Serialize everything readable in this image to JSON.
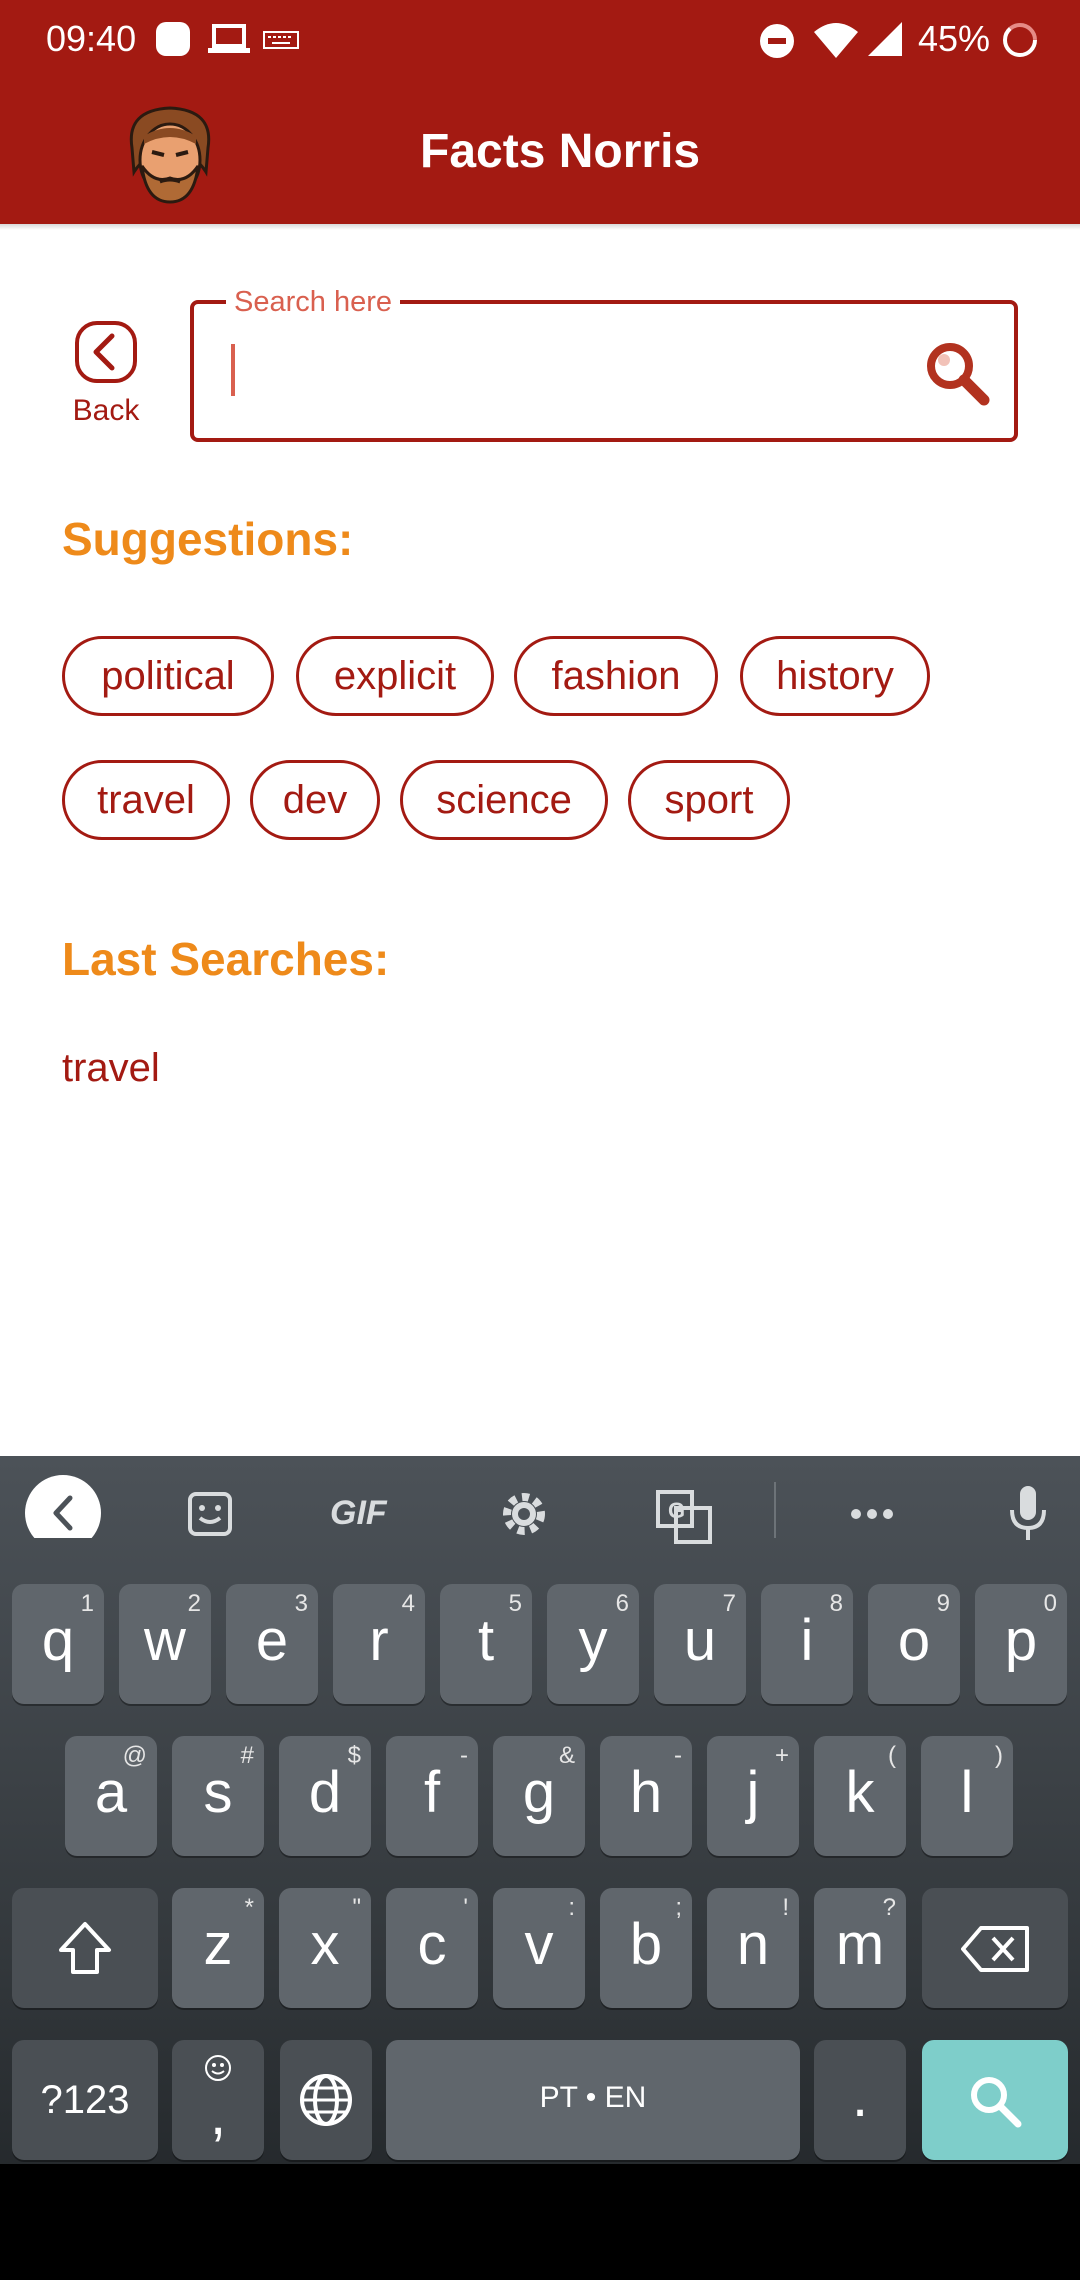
{
  "status_bar": {
    "time": "09:40",
    "battery": "45%"
  },
  "app": {
    "title": "Facts Norris"
  },
  "back": {
    "label": "Back"
  },
  "search": {
    "label": "Search here",
    "value": ""
  },
  "suggestions": {
    "title": "Suggestions:",
    "chips": [
      "political",
      "explicit",
      "fashion",
      "history",
      "travel",
      "dev",
      "science",
      "sport"
    ]
  },
  "last_searches": {
    "title": "Last Searches:",
    "items": [
      "travel"
    ]
  },
  "keyboard": {
    "toolbar_gif": "GIF",
    "row1": [
      {
        "k": "q",
        "s": "1"
      },
      {
        "k": "w",
        "s": "2"
      },
      {
        "k": "e",
        "s": "3"
      },
      {
        "k": "r",
        "s": "4"
      },
      {
        "k": "t",
        "s": "5"
      },
      {
        "k": "y",
        "s": "6"
      },
      {
        "k": "u",
        "s": "7"
      },
      {
        "k": "i",
        "s": "8"
      },
      {
        "k": "o",
        "s": "9"
      },
      {
        "k": "p",
        "s": "0"
      }
    ],
    "row2": [
      {
        "k": "a",
        "s": "@"
      },
      {
        "k": "s",
        "s": "#"
      },
      {
        "k": "d",
        "s": "$"
      },
      {
        "k": "f",
        "s": "-"
      },
      {
        "k": "g",
        "s": "&"
      },
      {
        "k": "h",
        "s": "-"
      },
      {
        "k": "j",
        "s": "+"
      },
      {
        "k": "k",
        "s": "("
      },
      {
        "k": "l",
        "s": ")"
      }
    ],
    "row3": [
      {
        "k": "z",
        "s": "*"
      },
      {
        "k": "x",
        "s": "\""
      },
      {
        "k": "c",
        "s": "'"
      },
      {
        "k": "v",
        "s": ":"
      },
      {
        "k": "b",
        "s": ";"
      },
      {
        "k": "n",
        "s": "!"
      },
      {
        "k": "m",
        "s": "?"
      }
    ],
    "symbols_label": "?123",
    "comma_label": ",",
    "space_label": "PT • EN",
    "period_label": "."
  },
  "colors": {
    "primary": "#a31a12",
    "accent": "#ee8a1a",
    "enter_key": "#7ececa"
  }
}
